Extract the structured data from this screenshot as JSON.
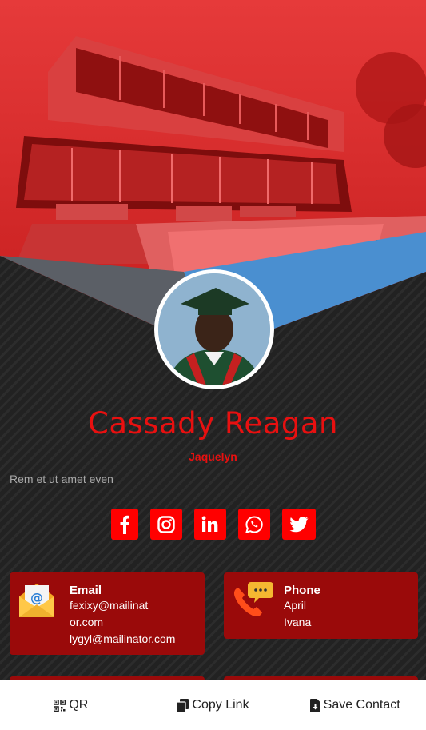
{
  "profile": {
    "name": "Cassady Reagan",
    "subtitle": "Jaquelyn",
    "bio": "Rem et ut amet even"
  },
  "socials": [
    {
      "icon": "facebook-icon"
    },
    {
      "icon": "instagram-icon"
    },
    {
      "icon": "linkedin-icon"
    },
    {
      "icon": "whatsapp-icon"
    },
    {
      "icon": "twitter-icon"
    }
  ],
  "contacts": {
    "email": {
      "title": "Email",
      "lines": [
        "fexixy@mailinat",
        "or.com",
        "lygyl@mailinator.com"
      ]
    },
    "phone": {
      "title": "Phone",
      "lines": [
        "April",
        "Ivana"
      ]
    }
  },
  "bottom_bar": {
    "qr_label": "QR",
    "copy_link_label": "Copy Link",
    "save_contact_label": "Save Contact"
  },
  "colors": {
    "accent": "#e81010",
    "card": "#9a0a0a",
    "social_bg": "#ff0000",
    "background": "#222222"
  }
}
